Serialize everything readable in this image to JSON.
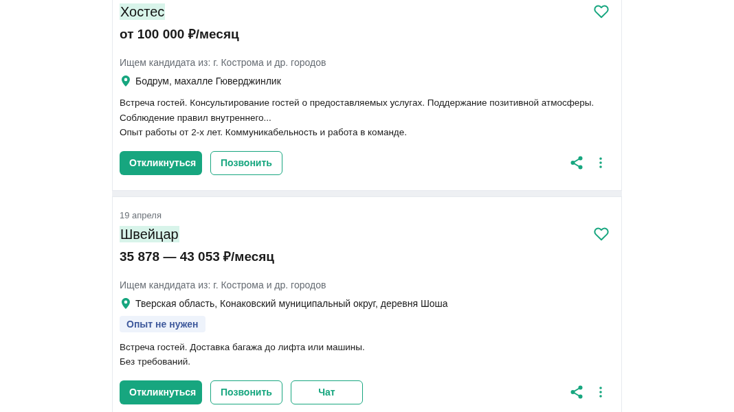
{
  "vacancies": [
    {
      "title": "Хостес",
      "title_highlighted": true,
      "favorite": false,
      "salary": "от 100 000 ₽/месяц",
      "candidates_from": "Ищем кандидата из: г. Кострома и др. городов",
      "location": "Бодрум, махалле Гюверджинлик",
      "description": [
        "Встреча гостей. Консультирование гостей о предоставляемых услугах. Поддержание позитивной атмосферы. Соблюдение правил внутреннего...",
        "Опыт работы от 2-х лет. Коммуникабельность и работа в команде."
      ],
      "buttons": [
        {
          "label": "Откликнуться",
          "kind": "primary"
        },
        {
          "label": "Позвонить",
          "kind": "outline"
        }
      ]
    },
    {
      "date": "19 апреля",
      "title": "Швейцар",
      "title_highlighted": true,
      "favorite": false,
      "salary": "35 878 — 43 053 ₽/месяц",
      "candidates_from": "Ищем кандидата из: г. Кострома и др. городов",
      "location": "Тверская область, Конаковский муниципальный округ, деревня Шоша",
      "tags": [
        "Опыт не нужен"
      ],
      "description": [
        "Встреча гостей. Доставка багажа до лифта или машины.",
        "Без требований."
      ],
      "buttons": [
        {
          "label": "Откликнуться",
          "kind": "primary"
        },
        {
          "label": "Позвонить",
          "kind": "outline"
        },
        {
          "label": "Чат",
          "kind": "outline-wide"
        }
      ]
    }
  ]
}
